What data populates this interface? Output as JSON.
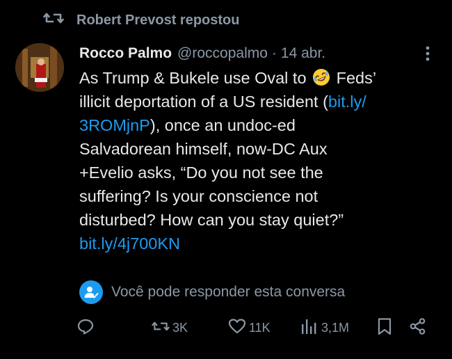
{
  "repost": {
    "text": "Robert Prevost repostou"
  },
  "author": {
    "name": "Rocco Palmo",
    "handle": "@roccopalmo",
    "separator": "·",
    "time": "14 abr."
  },
  "tweet": {
    "lines": [
      [
        "As Trump & Bukele use Oval to ",
        "🤣",
        " Feds’"
      ],
      [
        "illicit deportation of a US resident (",
        "bit.ly/"
      ],
      [
        "3ROMjnP",
        "), once an undoc-ed"
      ],
      [
        "Salvadorean himself, now-DC Aux"
      ],
      [
        "+Evelio asks, “Do you not see the"
      ],
      [
        "suffering? Is your conscience not"
      ],
      [
        "disturbed? How can you stay quiet?”"
      ],
      [
        "bit.ly/4j700KN"
      ]
    ],
    "line1_a": "As Trump & Bukele use Oval to",
    "line1_b": "Feds’",
    "line2_a": "illicit deportation of a US resident (",
    "line2_link": "bit.ly/",
    "line3_link": "3ROMjnP",
    "line3_b": "), once an undoc-ed",
    "line4": "Salvadorean himself, now-DC Aux",
    "line5": "+Evelio asks, “Do you not see the",
    "line6": "suffering? Is your conscience not",
    "line7": "disturbed? How can you stay quiet?”",
    "line8_link": "bit.ly/4j700KN",
    "emoji": "rolling-on-floor-laughing-emoji"
  },
  "reply_notice": {
    "text": "Você pode responder esta conversa"
  },
  "actions": {
    "reply_count": "",
    "repost_count": "3K",
    "like_count": "11K",
    "views_count": "3,1M"
  },
  "colors": {
    "background": "#000000",
    "text": "#e7e9ea",
    "muted": "#8b98a5",
    "link": "#1d9bf0"
  }
}
